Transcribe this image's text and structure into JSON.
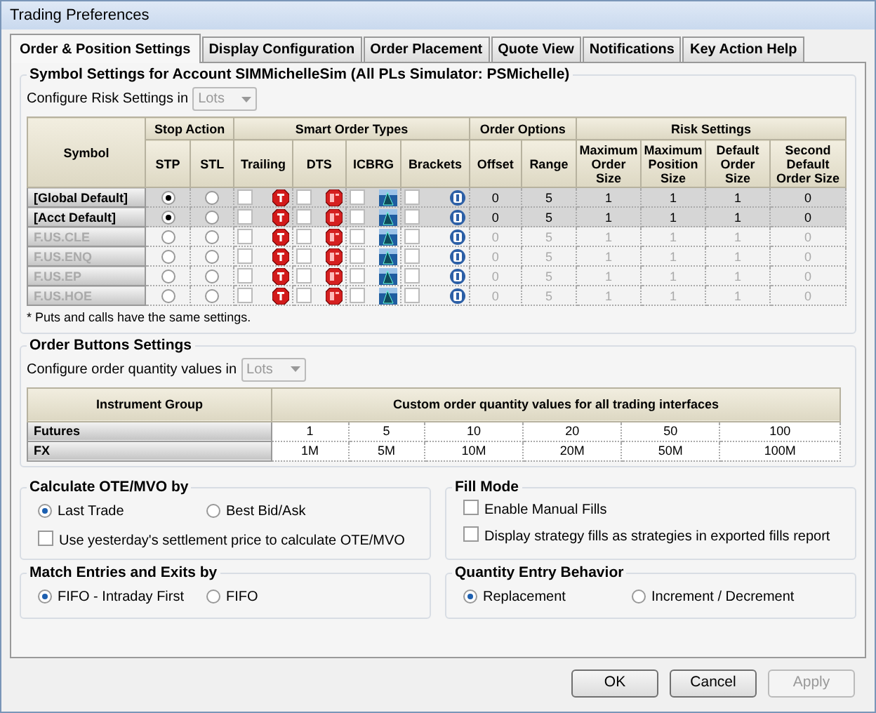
{
  "window": {
    "title": "Trading Preferences"
  },
  "tabs": [
    {
      "label": "Order & Position Settings",
      "selected": true
    },
    {
      "label": "Display Configuration",
      "selected": false
    },
    {
      "label": "Order Placement",
      "selected": false
    },
    {
      "label": "Quote View",
      "selected": false
    },
    {
      "label": "Notifications",
      "selected": false
    },
    {
      "label": "Key Action Help",
      "selected": false
    }
  ],
  "symbol_settings": {
    "title": "Symbol Settings for Account SIMMichelleSim (All PLs Simulator: PSMichelle)",
    "risk_label": "Configure Risk Settings in",
    "risk_unit": {
      "value": "Lots",
      "disabled": true
    },
    "symbol_header": "Symbol",
    "groups": [
      {
        "label": "Stop Action",
        "columns": [
          "STP",
          "STL"
        ]
      },
      {
        "label": "Smart Order Types",
        "columns": [
          "Trailing",
          "DTS",
          "ICBRG",
          "Brackets"
        ]
      },
      {
        "label": "Order Options",
        "columns": [
          "Offset",
          "Range"
        ]
      },
      {
        "label": "Risk Settings",
        "columns": [
          "Maximum Order Size",
          "Maximum Position Size",
          "Default Order Size",
          "Second Default Order Size"
        ]
      }
    ],
    "rows": [
      {
        "symbol": "[Global Default]",
        "disabled": false,
        "stp": true,
        "stl": false,
        "trailing": false,
        "dts": false,
        "icbrg": false,
        "brackets": false,
        "values": [
          "0",
          "5",
          "1",
          "1",
          "1",
          "0"
        ]
      },
      {
        "symbol": "[Acct Default]",
        "disabled": false,
        "stp": true,
        "stl": false,
        "trailing": false,
        "dts": false,
        "icbrg": false,
        "brackets": false,
        "values": [
          "0",
          "5",
          "1",
          "1",
          "1",
          "0"
        ]
      },
      {
        "symbol": "F.US.CLE",
        "disabled": true,
        "stp": false,
        "stl": false,
        "trailing": false,
        "dts": false,
        "icbrg": false,
        "brackets": false,
        "values": [
          "0",
          "5",
          "1",
          "1",
          "1",
          "0"
        ]
      },
      {
        "symbol": "F.US.ENQ",
        "disabled": true,
        "stp": false,
        "stl": false,
        "trailing": false,
        "dts": false,
        "icbrg": false,
        "brackets": false,
        "values": [
          "0",
          "5",
          "1",
          "1",
          "1",
          "0"
        ]
      },
      {
        "symbol": "F.US.EP",
        "disabled": true,
        "stp": false,
        "stl": false,
        "trailing": false,
        "dts": false,
        "icbrg": false,
        "brackets": false,
        "values": [
          "0",
          "5",
          "1",
          "1",
          "1",
          "0"
        ]
      },
      {
        "symbol": "F.US.HOE",
        "disabled": true,
        "stp": false,
        "stl": false,
        "trailing": false,
        "dts": false,
        "icbrg": false,
        "brackets": false,
        "values": [
          "0",
          "5",
          "1",
          "1",
          "1",
          "0"
        ]
      }
    ],
    "footnote": "* Puts and calls have the same settings."
  },
  "order_buttons": {
    "title": "Order Buttons Settings",
    "qty_label": "Configure order quantity values in",
    "qty_unit": {
      "value": "Lots",
      "disabled": true
    },
    "columns": [
      "Instrument Group",
      "Custom order quantity values for all trading interfaces"
    ],
    "rows": [
      {
        "group": "Futures",
        "values": [
          "1",
          "5",
          "10",
          "20",
          "50",
          "100"
        ]
      },
      {
        "group": "FX",
        "values": [
          "1M",
          "5M",
          "10M",
          "20M",
          "50M",
          "100M"
        ]
      }
    ]
  },
  "calculate": {
    "title": "Calculate OTE/MVO by",
    "options": [
      {
        "label": "Last Trade",
        "selected": true
      },
      {
        "label": "Best Bid/Ask",
        "selected": false
      }
    ],
    "checkbox": {
      "label": "Use yesterday's settlement price to calculate OTE/MVO",
      "checked": false
    }
  },
  "fill_mode": {
    "title": "Fill Mode",
    "checkboxes": [
      {
        "label": "Enable Manual Fills",
        "checked": false
      },
      {
        "label": "Display strategy fills as strategies in exported fills report",
        "checked": false
      }
    ]
  },
  "match": {
    "title": "Match Entries and Exits by",
    "options": [
      {
        "label": "FIFO - Intraday First",
        "selected": true
      },
      {
        "label": "FIFO",
        "selected": false
      }
    ]
  },
  "quantity_entry": {
    "title": "Quantity Entry Behavior",
    "options": [
      {
        "label": "Replacement",
        "selected": true
      },
      {
        "label": "Increment / Decrement",
        "selected": false
      }
    ]
  },
  "buttons": [
    {
      "label": "OK",
      "disabled": false
    },
    {
      "label": "Cancel",
      "disabled": false
    },
    {
      "label": "Apply",
      "disabled": true
    }
  ]
}
